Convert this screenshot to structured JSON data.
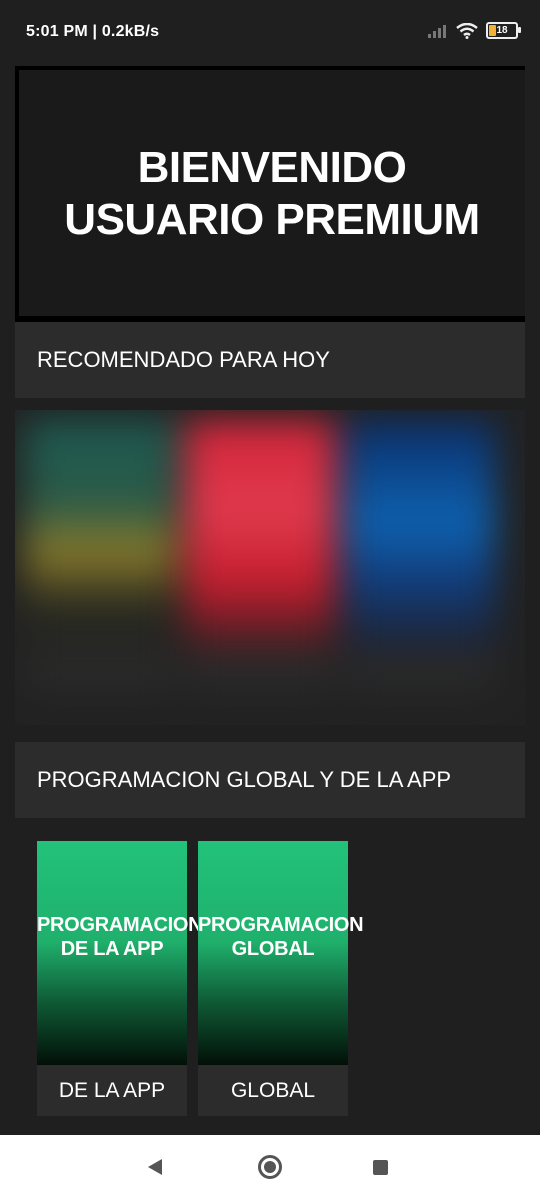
{
  "status_bar": {
    "time": "5:01 PM | 0.2kB/s",
    "battery": "18",
    "icons": [
      "signal-icon",
      "wifi-icon",
      "battery-icon"
    ]
  },
  "banner": {
    "line1": "BIENVENIDO",
    "line2": "USUARIO PREMIUM"
  },
  "sections": {
    "recommended": "RECOMENDADO PARA HOY",
    "programming": "PROGRAMACION GLOBAL Y DE LA APP"
  },
  "recommended_items": [
    {
      "colors": [
        "#1c5a52",
        "#8a7a2a"
      ]
    },
    {
      "colors": [
        "#d3253a",
        "#c51e2f"
      ]
    },
    {
      "colors": [
        "#0b2f6b",
        "#0e62b0"
      ]
    }
  ],
  "cards": [
    {
      "image_title_line1": "PROGRAMACION",
      "image_title_line2": "DE LA APP",
      "label": "DE LA APP"
    },
    {
      "image_title_line1": "PROGRAMACION",
      "image_title_line2": "GLOBAL",
      "label": "GLOBAL"
    }
  ],
  "nav": {
    "icons": [
      "back-icon",
      "home-icon",
      "recent-apps-icon"
    ]
  }
}
